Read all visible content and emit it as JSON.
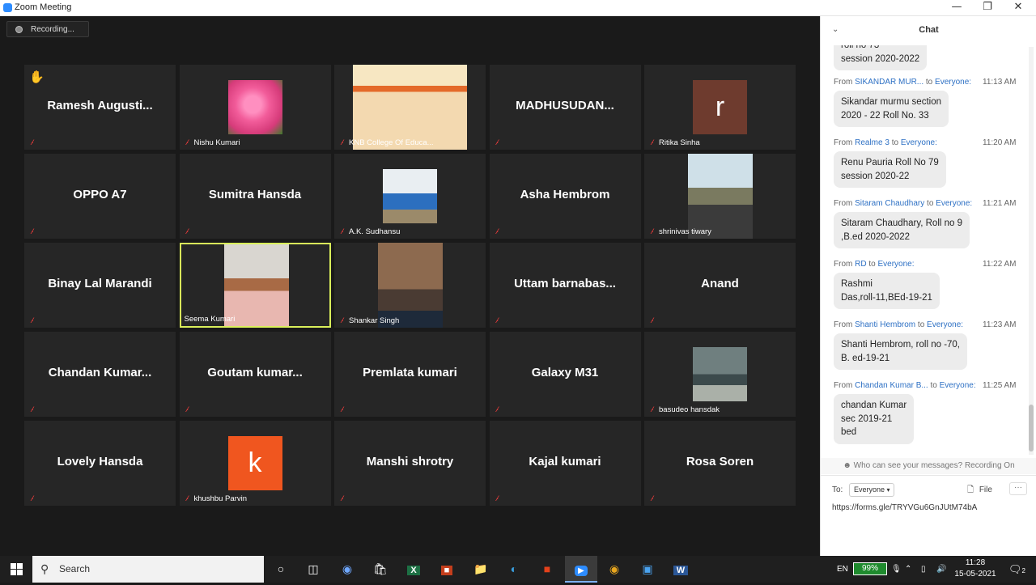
{
  "window": {
    "title": "Zoom Meeting",
    "minimize": "—",
    "maximize": "❐",
    "close": "✕"
  },
  "meeting": {
    "recording_label": "Recording..."
  },
  "participants": [
    {
      "big": "Ramesh  Augusti...",
      "label": "",
      "hand": true
    },
    {
      "big": "",
      "label": "Nishu Kumari",
      "pic": "flower"
    },
    {
      "big": "",
      "label": "KNB College Of Educa...",
      "pic": "college"
    },
    {
      "big": "MADHUSUDAN...",
      "label": ""
    },
    {
      "big": "",
      "label": "Ritika Sinha",
      "avatar": "r"
    },
    {
      "big": "OPPO A7",
      "label": ""
    },
    {
      "big": "Sumitra Hansda",
      "label": ""
    },
    {
      "big": "",
      "label": "A.K. Sudhansu",
      "pic": "desk"
    },
    {
      "big": "Asha Hembrom",
      "label": ""
    },
    {
      "big": "",
      "label": "shrinivas tiwary",
      "pic": "outdoor"
    },
    {
      "big": "Binay Lal Marandi",
      "label": ""
    },
    {
      "big": "",
      "label": "Seema Kumari",
      "pic": "seema",
      "active": true
    },
    {
      "big": "",
      "label": "Shankar Singh",
      "pic": "brick"
    },
    {
      "big": "Uttam  barnabas...",
      "label": ""
    },
    {
      "big": "Anand",
      "label": ""
    },
    {
      "big": "Chandan  Kumar...",
      "label": ""
    },
    {
      "big": "Goutam  kumar...",
      "label": ""
    },
    {
      "big": "Premlata kumari",
      "label": ""
    },
    {
      "big": "Galaxy M31",
      "label": ""
    },
    {
      "big": "",
      "label": "basudeo hansdak",
      "pic": "river"
    },
    {
      "big": "Lovely Hansda",
      "label": ""
    },
    {
      "big": "",
      "label": "khushbu Parvin",
      "avatar": "k"
    },
    {
      "big": "Manshi shrotry",
      "label": ""
    },
    {
      "big": "Kajal kumari",
      "label": ""
    },
    {
      "big": "Rosa Soren",
      "label": ""
    }
  ],
  "chat": {
    "title": "Chat",
    "partial_bubble": "roll no 73\nsession 2020-2022",
    "messages": [
      {
        "from": "From",
        "sender": "SIKANDAR MUR...",
        "to": "to",
        "target": "Everyone:",
        "time": "11:13 AM",
        "text": "Sikandar murmu section\n2020 - 22 Roll No. 33"
      },
      {
        "from": "From",
        "sender": "Realme 3",
        "to": "to",
        "target": "Everyone:",
        "time": "11:20 AM",
        "text": "Renu Pauria Roll No 79\nsession 2020-22"
      },
      {
        "from": "From",
        "sender": "Sitaram Chaudhary",
        "to": "to",
        "target": "Everyone:",
        "time": "11:21 AM",
        "text": "Sitaram Chaudhary, Roll no 9\n,B.ed 2020-2022"
      },
      {
        "from": "From",
        "sender": "RD",
        "to": "to",
        "target": "Everyone:",
        "time": "11:22 AM",
        "text": "Rashmi\nDas,roll-11,BEd-19-21"
      },
      {
        "from": "From",
        "sender": "Shanti Hembrom",
        "to": "to",
        "target": "Everyone:",
        "time": "11:23 AM",
        "text": "Shanti Hembrom, roll no -70,\nB. ed-19-21"
      },
      {
        "from": "From",
        "sender": "Chandan Kumar B...",
        "to": "to",
        "target": "Everyone:",
        "time": "11:25 AM",
        "text": "chandan Kumar\nsec 2019-21\nbed"
      }
    ],
    "who_can_see": "Who can see your messages? Recording On",
    "to_label": "To:",
    "to_value": "Everyone",
    "file_label": "File",
    "more_label": "···",
    "input_value": "https://forms.gle/TRYVGu6GnJUtM74bA"
  },
  "taskbar": {
    "search_placeholder": "Search",
    "lang": "EN",
    "battery": "99%",
    "time": "11:28",
    "date": "15-05-2021",
    "notif_count": "2"
  }
}
